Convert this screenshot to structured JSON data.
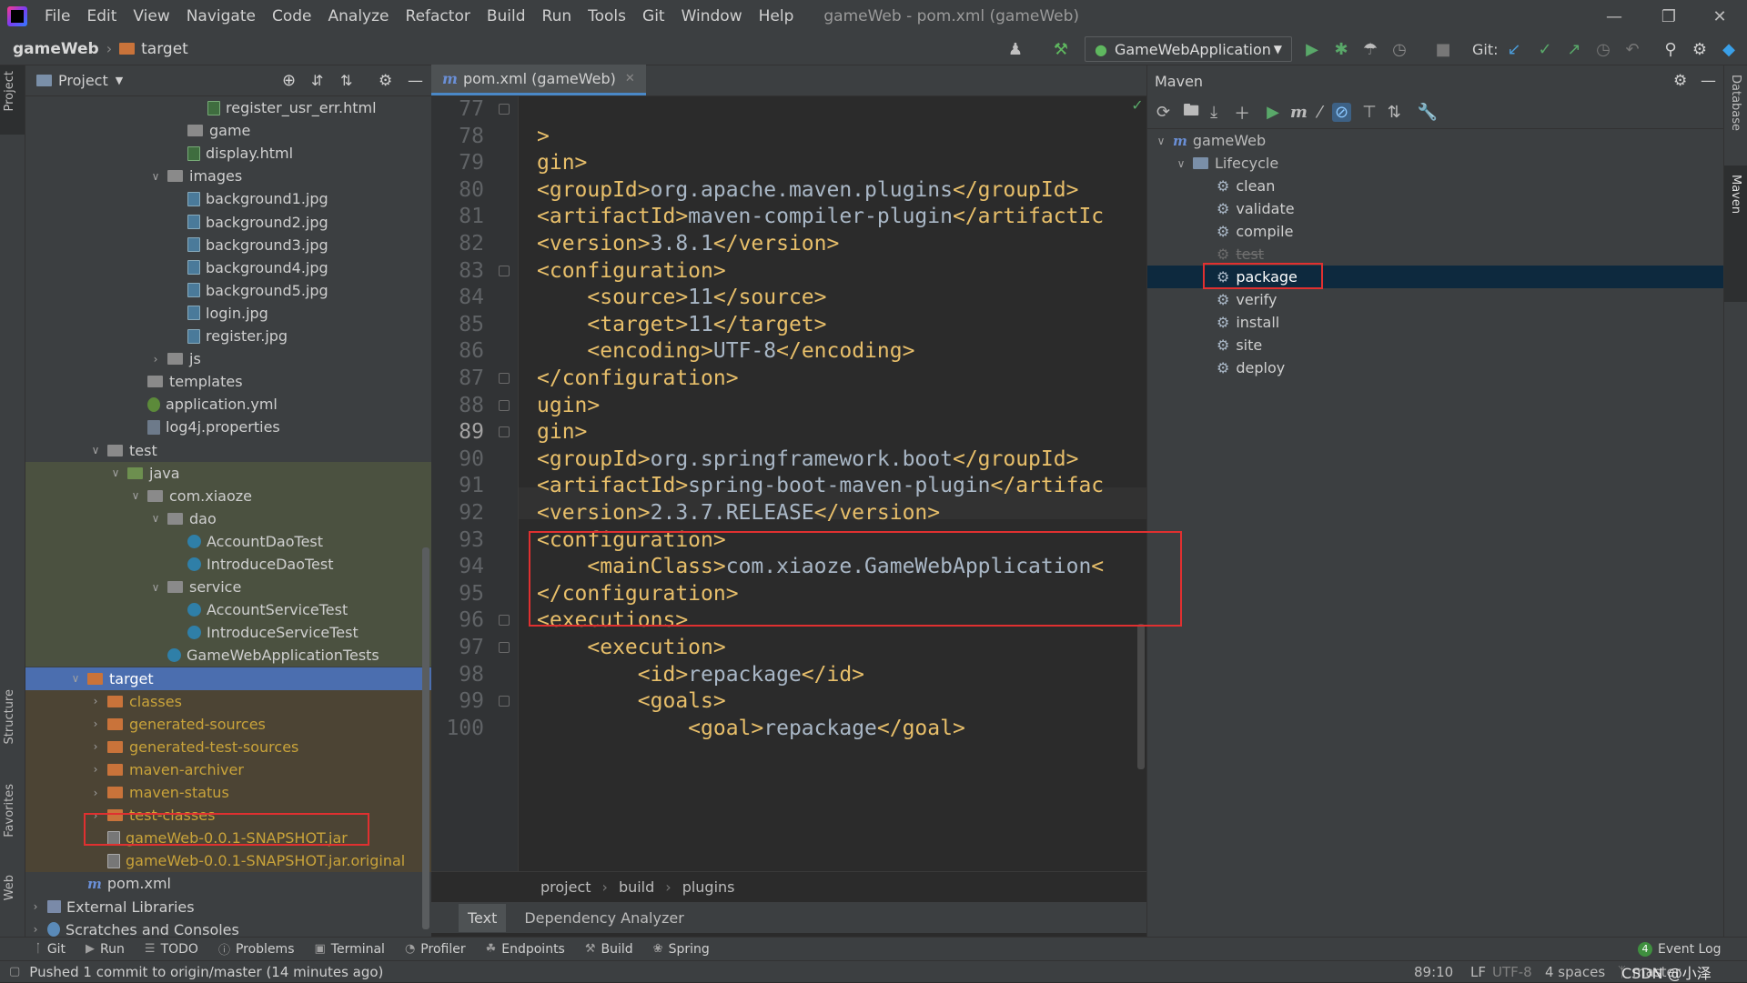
{
  "menubar": {
    "items": [
      "File",
      "Edit",
      "View",
      "Navigate",
      "Code",
      "Analyze",
      "Refactor",
      "Build",
      "Run",
      "Tools",
      "Git",
      "Window",
      "Help"
    ],
    "title": "gameWeb - pom.xml (gameWeb)"
  },
  "navbar": {
    "project": "gameWeb",
    "folder": "target",
    "run_config": "GameWebApplication",
    "git_label": "Git:"
  },
  "left_strip": {
    "project": "Project",
    "structure": "Structure",
    "favorites": "Favorites",
    "web": "Web"
  },
  "right_strip": {
    "database": "Database",
    "maven": "Maven"
  },
  "project_panel": {
    "title": "Project",
    "rows": [
      {
        "label": "register_usr_err.html",
        "icon": "html",
        "indent": 8,
        "arrow": ""
      },
      {
        "label": "game",
        "icon": "folder",
        "indent": 7,
        "arrow": ""
      },
      {
        "label": "display.html",
        "icon": "html",
        "indent": 7,
        "arrow": ""
      },
      {
        "label": "images",
        "icon": "folder",
        "indent": 6,
        "arrow": "open"
      },
      {
        "label": "background1.jpg",
        "icon": "img",
        "indent": 7,
        "arrow": ""
      },
      {
        "label": "background2.jpg",
        "icon": "img",
        "indent": 7,
        "arrow": ""
      },
      {
        "label": "background3.jpg",
        "icon": "img",
        "indent": 7,
        "arrow": ""
      },
      {
        "label": "background4.jpg",
        "icon": "img",
        "indent": 7,
        "arrow": ""
      },
      {
        "label": "background5.jpg",
        "icon": "img",
        "indent": 7,
        "arrow": ""
      },
      {
        "label": "login.jpg",
        "icon": "img",
        "indent": 7,
        "arrow": ""
      },
      {
        "label": "register.jpg",
        "icon": "img",
        "indent": 7,
        "arrow": ""
      },
      {
        "label": "js",
        "icon": "folder",
        "indent": 6,
        "arrow": "closed"
      },
      {
        "label": "templates",
        "icon": "folder",
        "indent": 5,
        "arrow": ""
      },
      {
        "label": "application.yml",
        "icon": "yml",
        "indent": 5,
        "arrow": ""
      },
      {
        "label": "log4j.properties",
        "icon": "prop",
        "indent": 5,
        "arrow": ""
      },
      {
        "label": "test",
        "icon": "folder",
        "indent": 3,
        "arrow": "open"
      },
      {
        "label": "java",
        "icon": "folder-green",
        "indent": 4,
        "arrow": "open",
        "tint": true
      },
      {
        "label": "com.xiaoze",
        "icon": "folder",
        "indent": 5,
        "arrow": "open",
        "tint": true
      },
      {
        "label": "dao",
        "icon": "folder",
        "indent": 6,
        "arrow": "open",
        "tint": true
      },
      {
        "label": "AccountDaoTest",
        "icon": "cls",
        "indent": 7,
        "arrow": "",
        "tint": true
      },
      {
        "label": "IntroduceDaoTest",
        "icon": "cls",
        "indent": 7,
        "arrow": "",
        "tint": true
      },
      {
        "label": "service",
        "icon": "folder",
        "indent": 6,
        "arrow": "open",
        "tint": true
      },
      {
        "label": "AccountServiceTest",
        "icon": "cls",
        "indent": 7,
        "arrow": "",
        "tint": true
      },
      {
        "label": "IntroduceServiceTest",
        "icon": "cls",
        "indent": 7,
        "arrow": "",
        "tint": true
      },
      {
        "label": "GameWebApplicationTests",
        "icon": "cls",
        "indent": 6,
        "arrow": "",
        "tint": true
      },
      {
        "label": "target",
        "icon": "folder-orange",
        "indent": 2,
        "arrow": "open",
        "selected": true
      },
      {
        "label": "classes",
        "icon": "folder-orange",
        "indent": 3,
        "arrow": "closed",
        "excluded": true
      },
      {
        "label": "generated-sources",
        "icon": "folder-orange",
        "indent": 3,
        "arrow": "closed",
        "excluded": true
      },
      {
        "label": "generated-test-sources",
        "icon": "folder-orange",
        "indent": 3,
        "arrow": "closed",
        "excluded": true
      },
      {
        "label": "maven-archiver",
        "icon": "folder-orange",
        "indent": 3,
        "arrow": "closed",
        "excluded": true
      },
      {
        "label": "maven-status",
        "icon": "folder-orange",
        "indent": 3,
        "arrow": "closed",
        "excluded": true
      },
      {
        "label": "test-classes",
        "icon": "folder-orange",
        "indent": 3,
        "arrow": "closed",
        "excluded": true
      },
      {
        "label": "gameWeb-0.0.1-SNAPSHOT.jar",
        "icon": "jar",
        "indent": 3,
        "arrow": "",
        "excluded": true
      },
      {
        "label": "gameWeb-0.0.1-SNAPSHOT.jar.original",
        "icon": "jar",
        "indent": 3,
        "arrow": "",
        "excluded": true
      },
      {
        "label": "pom.xml",
        "icon": "mvn",
        "indent": 2,
        "arrow": ""
      },
      {
        "label": "External Libraries",
        "icon": "lib",
        "indent": 0,
        "arrow": "closed"
      },
      {
        "label": "Scratches and Consoles",
        "icon": "scr",
        "indent": 0,
        "arrow": "closed"
      }
    ]
  },
  "editor": {
    "tab": "pom.xml (gameWeb)",
    "tab_icon": "m",
    "lines": [
      {
        "n": "77",
        "text": ""
      },
      {
        "n": "78",
        "text": ">"
      },
      {
        "n": "79",
        "text": "gin>"
      },
      {
        "n": "80",
        "text": "<groupId>org.apache.maven.plugins</groupId>"
      },
      {
        "n": "81",
        "text": "<artifactId>maven-compiler-plugin</artifactIc"
      },
      {
        "n": "82",
        "text": "<version>3.8.1</version>"
      },
      {
        "n": "83",
        "text": "<configuration>"
      },
      {
        "n": "84",
        "text": "    <source>11</source>"
      },
      {
        "n": "85",
        "text": "    <target>11</target>"
      },
      {
        "n": "86",
        "text": "    <encoding>UTF-8</encoding>"
      },
      {
        "n": "87",
        "text": "</configuration>"
      },
      {
        "n": "88",
        "text": "ugin>"
      },
      {
        "n": "89",
        "text": "gin>"
      },
      {
        "n": "90",
        "text": "<groupId>org.springframework.boot</groupId>"
      },
      {
        "n": "91",
        "text": "<artifactId>spring-boot-maven-plugin</artifac"
      },
      {
        "n": "92",
        "text": "<version>2.3.7.RELEASE</version>"
      },
      {
        "n": "93",
        "text": "<configuration>"
      },
      {
        "n": "94",
        "text": "    <mainClass>com.xiaoze.GameWebApplication<"
      },
      {
        "n": "95",
        "text": "</configuration>"
      },
      {
        "n": "96",
        "text": "<executions>"
      },
      {
        "n": "97",
        "text": "    <execution>"
      },
      {
        "n": "98",
        "text": "        <id>repackage</id>"
      },
      {
        "n": "99",
        "text": "        <goals>"
      },
      {
        "n": "100",
        "text": "            <goal>repackage</goal>"
      }
    ],
    "breadcrumb": [
      "project",
      "build",
      "plugins"
    ],
    "bottom_tabs": [
      "Text",
      "Dependency Analyzer"
    ]
  },
  "maven": {
    "title": "Maven",
    "project": "gameWeb",
    "lifecycle": "Lifecycle",
    "phases": [
      {
        "label": "clean"
      },
      {
        "label": "validate"
      },
      {
        "label": "compile"
      },
      {
        "label": "test",
        "disabled": true
      },
      {
        "label": "package",
        "selected": true
      },
      {
        "label": "verify"
      },
      {
        "label": "install"
      },
      {
        "label": "site"
      },
      {
        "label": "deploy"
      }
    ]
  },
  "toolstrip": {
    "items": [
      {
        "label": "Git",
        "icon": "branch-icon"
      },
      {
        "label": "Run",
        "icon": "play-icon"
      },
      {
        "label": "TODO",
        "icon": "list-icon"
      },
      {
        "label": "Problems",
        "icon": "info-icon"
      },
      {
        "label": "Terminal",
        "icon": "terminal-icon"
      },
      {
        "label": "Profiler",
        "icon": "profiler-icon"
      },
      {
        "label": "Endpoints",
        "icon": "endpoints-icon"
      },
      {
        "label": "Build",
        "icon": "hammer-icon"
      },
      {
        "label": "Spring",
        "icon": "spring-icon"
      }
    ],
    "event_count": "4",
    "event_log": "Event Log"
  },
  "status": {
    "message": "Pushed 1 commit to origin/master (14 minutes ago)",
    "position": "89:10",
    "line_sep": "LF",
    "encoding": "UTF-8",
    "indent": "4 spaces",
    "branch": "master",
    "watermark": "CSDN @小泽"
  }
}
